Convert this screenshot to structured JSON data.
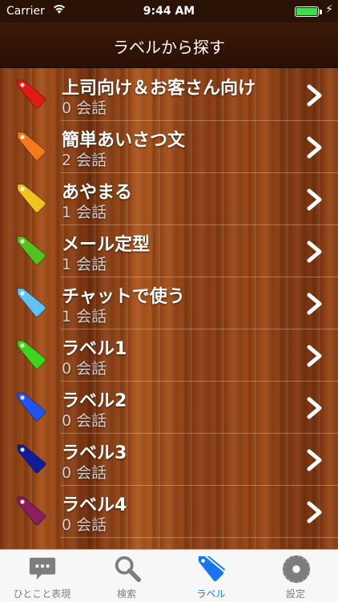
{
  "status_bar": {
    "carrier": "Carrier",
    "time": "9:44 AM",
    "battery_color": "#3ddc4b"
  },
  "nav": {
    "title": "ラベルから探す"
  },
  "labels": [
    {
      "name": "上司向け＆お客さん向け",
      "count": "0 会話",
      "color": "#e01a16"
    },
    {
      "name": "簡単あいさつ文",
      "count": "2 会話",
      "color": "#f27a1a"
    },
    {
      "name": "あやまる",
      "count": "1 会話",
      "color": "#f2c21d"
    },
    {
      "name": "メール定型",
      "count": "1 会話",
      "color": "#53c21e"
    },
    {
      "name": "チャットで使う",
      "count": "1 会話",
      "color": "#5cc3f2"
    },
    {
      "name": "ラベル1",
      "count": "0 会話",
      "color": "#3cd51a"
    },
    {
      "name": "ラベル2",
      "count": "0 会話",
      "color": "#1f54f0"
    },
    {
      "name": "ラベル3",
      "count": "0 会話",
      "color": "#111c9a"
    },
    {
      "name": "ラベル4",
      "count": "0 会話",
      "color": "#8c1d63"
    }
  ],
  "tabs": [
    {
      "label": "ひとこと表現",
      "icon": "speech-bubble-icon",
      "active": false
    },
    {
      "label": "検索",
      "icon": "magnifier-icon",
      "active": false
    },
    {
      "label": "ラベル",
      "icon": "tag-icon",
      "active": true
    },
    {
      "label": "設定",
      "icon": "gear-icon",
      "active": false
    }
  ],
  "colors": {
    "tab_active": "#1976f3",
    "tab_inactive": "#7d7d7d"
  }
}
